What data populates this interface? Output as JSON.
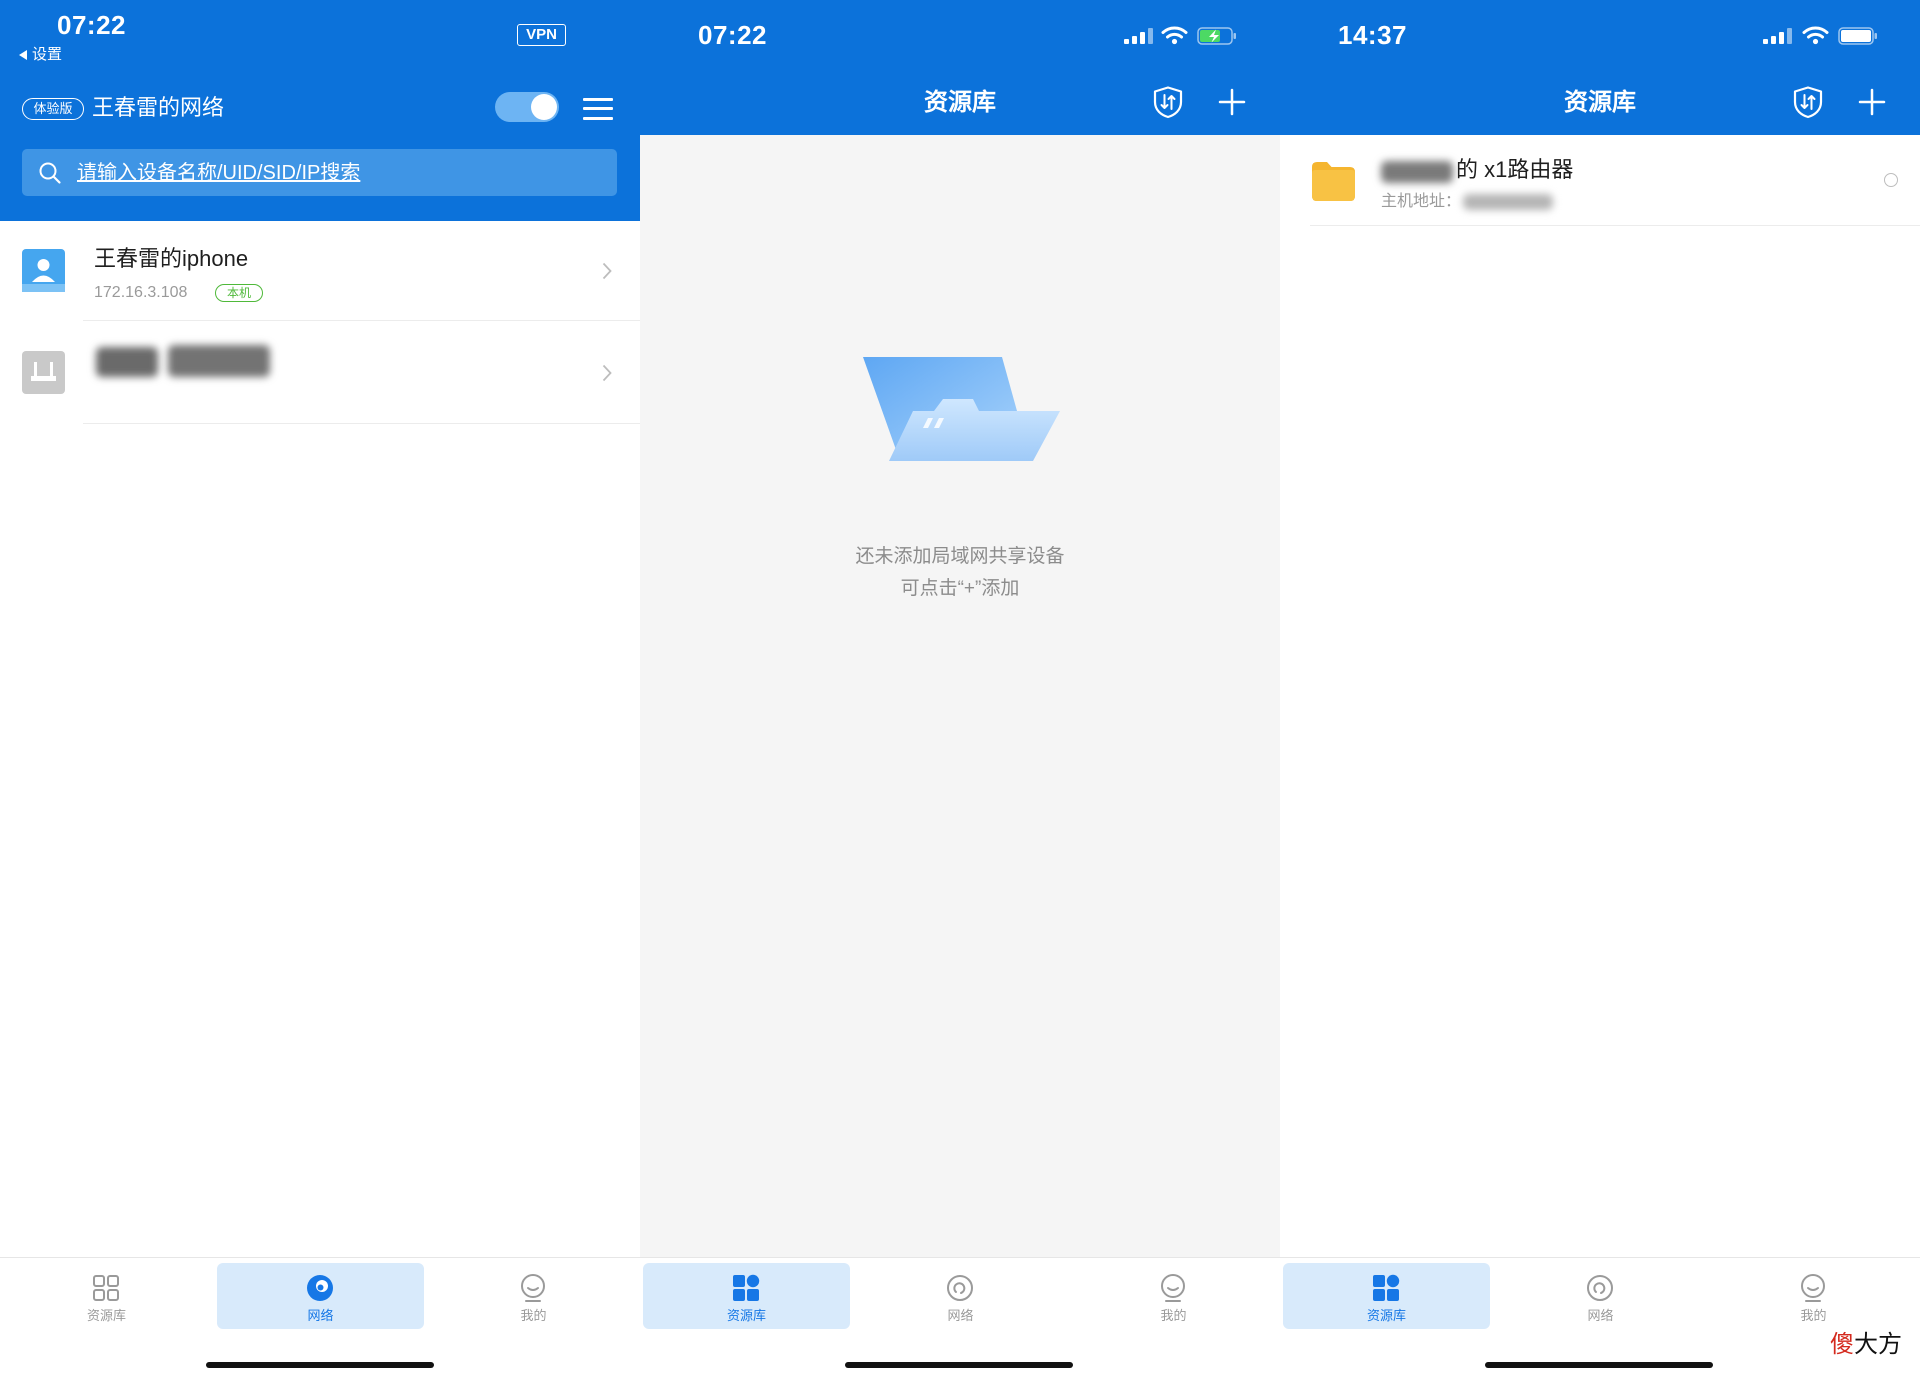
{
  "colors": {
    "primary_blue": "#0c72da",
    "search_bg": "#3f95e5",
    "toggle_track": "#6db4f3",
    "tab_highlight": "#d8eafb",
    "tab_active": "#1677e6",
    "tab_inactive": "#9a9a9a",
    "badge_green": "#4fb93a",
    "folder_yellow": "#f8c244",
    "empty_background": "#f5f5f5"
  },
  "network_screen": {
    "status_bar": {
      "time": "07:22",
      "back_label": "设置",
      "vpn_label": "VPN"
    },
    "header": {
      "edition_badge": "体验版",
      "network_name": "王春雷的网络",
      "toggle_on": true,
      "menu_icon": "hamburger-menu-icon"
    },
    "search": {
      "placeholder": "请输入设备名称/UID/SID/IP搜索",
      "icon": "search-icon"
    },
    "devices": [
      {
        "name": "王春雷的iphone",
        "ip": "172.16.3.108",
        "badge": "本机",
        "icon": "user-icon"
      },
      {
        "icon": "router-icon",
        "name_redacted": true
      }
    ],
    "tabs": [
      {
        "label": "资源库",
        "icon": "library-grid-icon"
      },
      {
        "label": "网络",
        "icon": "network-icon"
      },
      {
        "label": "我的",
        "icon": "profile-icon"
      }
    ],
    "active_tab_index": 1
  },
  "library_empty_screen": {
    "status_bar": {
      "time": "07:22",
      "battery_charging": true
    },
    "header": {
      "title": "资源库",
      "actions": [
        "transfer-shield-icon",
        "add-icon"
      ]
    },
    "empty_state": {
      "line1": "还未添加局域网共享设备",
      "line2": "可点击“+”添加",
      "illustration": "empty-folder-illustration"
    },
    "tabs": [
      {
        "label": "资源库",
        "icon": "library-grid-icon"
      },
      {
        "label": "网络",
        "icon": "network-icon"
      },
      {
        "label": "我的",
        "icon": "profile-icon"
      }
    ],
    "active_tab_index": 0
  },
  "library_list_screen": {
    "status_bar": {
      "time": "14:37",
      "battery_charging": false
    },
    "header": {
      "title": "资源库",
      "actions": [
        "transfer-shield-icon",
        "add-icon"
      ]
    },
    "shares": [
      {
        "name_visible": "的 x1路由器",
        "name_prefix_redacted": true,
        "host_label": "主机地址：",
        "host_redacted": true,
        "icon": "folder-icon",
        "selected": false
      }
    ],
    "tabs": [
      {
        "label": "资源库",
        "icon": "library-grid-icon"
      },
      {
        "label": "网络",
        "icon": "network-icon"
      },
      {
        "label": "我的",
        "icon": "profile-icon"
      }
    ],
    "active_tab_index": 0
  },
  "watermark": {
    "first": "傻",
    "rest": "大方"
  }
}
